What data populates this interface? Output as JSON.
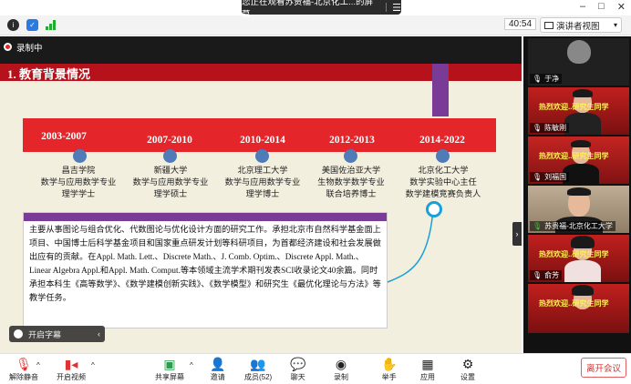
{
  "share_banner": {
    "text": "您正在观看苏贵福-北京化工...的屏幕",
    "menu_icon": "menu-icon"
  },
  "window_controls": {
    "minimize": "–",
    "maximize": "□",
    "close": "✕"
  },
  "topbar": {
    "timer": "40:54",
    "view_button": "演讲者视图"
  },
  "recording": {
    "label": "录制中"
  },
  "slide": {
    "title": "1. 教育背景情况",
    "timeline": [
      {
        "years": "2003-2007",
        "inst": [
          "昌吉学院",
          "数学与应用数学专业",
          "理学学士"
        ]
      },
      {
        "years": "2007-2010",
        "inst": [
          "新疆大学",
          "数学与应用数学专业",
          "理学硕士"
        ]
      },
      {
        "years": "2010-2014",
        "inst": [
          "北京理工大学",
          "数学与应用数学专业",
          "理学博士"
        ]
      },
      {
        "years": "2012-2013",
        "inst": [
          "美国佐治亚大学",
          "生物数学数学专业",
          "联合培养博士"
        ]
      },
      {
        "years": "2014-2022",
        "inst": [
          "北京化工大学",
          "数学实验中心主任",
          "数学建模竞赛负责人"
        ]
      }
    ],
    "description": "主要从事图论与组合优化、代数图论与优化设计方面的研究工作。承担北京市自然科学基金面上项目、中国博士后科学基金项目和国家重点研发计划等科研项目，为首都经济建设和社会发展做出应有的贡献。在Appl. Math. Lett.、Discrete Math.、J. Comb. Optim.、Discrete Appl. Math.、Linear Algebra Appl.和Appl. Math. Comput.等本领域主流学术期刊发表SCI收录论文40余篇。同时承担本科生《高等数学》、《数学建模创新实践》、《数学模型》和研究生《最优化理论与方法》等教学任务。"
  },
  "cc_pill": {
    "label": "开启字幕"
  },
  "participants": [
    {
      "name": "于净",
      "banner": ""
    },
    {
      "name": "陈敏刚",
      "banner": "热烈欢迎..研究生同学"
    },
    {
      "name": "刘福国",
      "banner": "热烈欢迎..研究生同学"
    },
    {
      "name": "苏贵福-北京化工大学",
      "banner": ""
    },
    {
      "name": "俞芳",
      "banner": "热烈欢迎..研究生同学"
    },
    {
      "name": "",
      "banner": "热烈欢迎..研究生同学"
    }
  ],
  "toolbar": {
    "mute": "解除静音",
    "video": "开启视频",
    "share": "共享屏幕",
    "invite": "邀请",
    "members": "成员(52)",
    "chat": "聊天",
    "record": "录制",
    "raise_hand": "举手",
    "apps": "应用",
    "settings": "设置",
    "leave": "离开会议"
  }
}
